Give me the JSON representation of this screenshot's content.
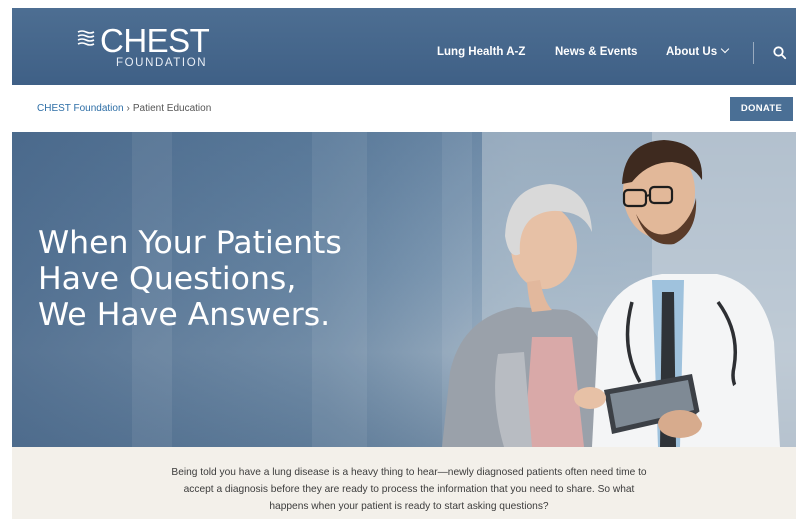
{
  "header": {
    "logo_word": "CHEST",
    "logo_sub": "FOUNDATION",
    "nav": [
      {
        "label": "Lung Health A-Z"
      },
      {
        "label": "News & Events"
      },
      {
        "label": "About Us"
      }
    ],
    "search_icon": "search-icon"
  },
  "breadcrumb": {
    "home": "CHEST Foundation",
    "separator": "›",
    "current": "Patient Education"
  },
  "donate_label": "DONATE",
  "hero": {
    "title": "When Your Patients\nHave Questions,\nWe Have Answers."
  },
  "intro": {
    "text": "Being told you have a lung disease is a heavy thing to hear—newly diagnosed patients often need time to accept a diagnosis before they are ready to process the information that you need to share. So what happens when your patient is ready to start asking questions?"
  },
  "colors": {
    "header_bg": "#4a6b90",
    "donate_bg": "#4a6f95",
    "link": "#2d6ea6",
    "intro_bg": "#f3f0ea"
  }
}
